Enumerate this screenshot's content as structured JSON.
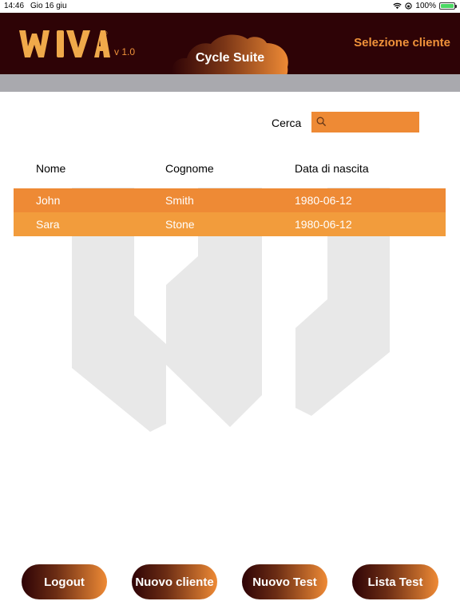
{
  "status_bar": {
    "time": "14:46",
    "date": "Gio 16 giu",
    "battery": "100%"
  },
  "header": {
    "logo_text": "WIVA",
    "version": "v 1.0",
    "app_title": "Cycle Suite",
    "page_title": "Selezione cliente"
  },
  "search": {
    "label": "Cerca",
    "value": "",
    "placeholder": ""
  },
  "table": {
    "columns": [
      "Nome",
      "Cognome",
      "Data di nascita"
    ],
    "rows": [
      {
        "nome": "John",
        "cognome": "Smith",
        "data": "1980-06-12"
      },
      {
        "nome": "Sara",
        "cognome": "Stone",
        "data": "1980-06-12"
      }
    ]
  },
  "buttons": {
    "logout": "Logout",
    "new_client": "Nuovo cliente",
    "new_test": "Nuovo Test",
    "test_list": "Lista Test"
  },
  "colors": {
    "header_bg": "#2e0306",
    "accent": "#ee8a35",
    "row_1": "#ee8a35",
    "row_2": "#f29c3c",
    "gray_bar": "#a9a9ae"
  }
}
